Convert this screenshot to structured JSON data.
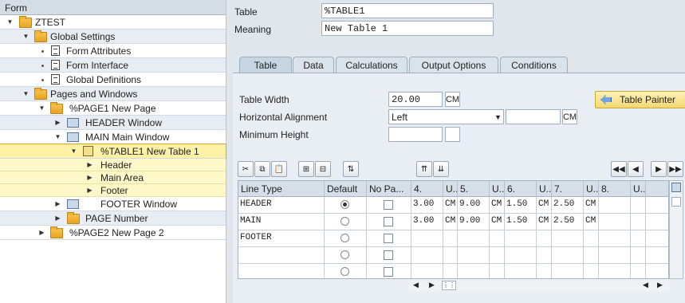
{
  "left_header": "Form",
  "tree": [
    {
      "label": "ZTEST"
    },
    {
      "label": "Global Settings"
    },
    {
      "label": "Form Attributes"
    },
    {
      "label": "Form Interface"
    },
    {
      "label": "Global Definitions"
    },
    {
      "label": "Pages and Windows"
    },
    {
      "label": "%PAGE1 New Page"
    },
    {
      "label": "HEADER Window"
    },
    {
      "label": "MAIN Main Window"
    },
    {
      "label": "%TABLE1 New Table 1"
    },
    {
      "label": "Header"
    },
    {
      "label": "Main Area"
    },
    {
      "label": "Footer"
    },
    {
      "label": "FOOTER Window"
    },
    {
      "label": "PAGE Number"
    },
    {
      "label": "%PAGE2 New Page 2"
    }
  ],
  "form": {
    "table_label": "Table",
    "table_value": "%TABLE1",
    "meaning_label": "Meaning",
    "meaning_value": "New Table 1"
  },
  "tabs": [
    "Table",
    "Data",
    "Calculations",
    "Output Options",
    "Conditions"
  ],
  "panel": {
    "table_width_label": "Table Width",
    "table_width_value": "20.00",
    "table_width_unit": "CM",
    "halign_label": "Horizontal Alignment",
    "halign_value": "Left",
    "halign_unit": "CM",
    "min_height_label": "Minimum Height",
    "table_painter_label": "Table Painter"
  },
  "grid": {
    "headers": [
      "Line Type",
      "Default",
      "No Pa...",
      "4.",
      "U..",
      "5.",
      "U..",
      "6.",
      "U..",
      "7.",
      "U..",
      "8.",
      "U.."
    ],
    "rows": [
      {
        "type": "HEADER",
        "default": true,
        "cells": [
          "3.00",
          "CM",
          "9.00",
          "CM",
          "1.50",
          "CM",
          "2.50",
          "CM",
          "",
          ""
        ]
      },
      {
        "type": "MAIN",
        "default": false,
        "cells": [
          "3.00",
          "CM",
          "9.00",
          "CM",
          "1.50",
          "CM",
          "2.50",
          "CM",
          "",
          ""
        ]
      },
      {
        "type": "FOOTER",
        "default": false,
        "cells": [
          "",
          "",
          "",
          "",
          "",
          "",
          "",
          "",
          "",
          ""
        ]
      },
      {
        "type": "",
        "default": false,
        "cells": [
          "",
          "",
          "",
          "",
          "",
          "",
          "",
          "",
          "",
          ""
        ]
      },
      {
        "type": "",
        "default": false,
        "cells": [
          "",
          "",
          "",
          "",
          "",
          "",
          "",
          "",
          "",
          ""
        ]
      }
    ]
  },
  "colors": {
    "selected_row": "#fff1a6",
    "table_painter_btn": "#f3d870"
  }
}
